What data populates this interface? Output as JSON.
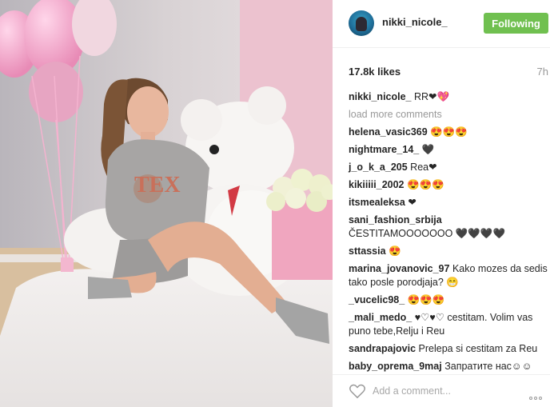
{
  "post": {
    "author": "nikki_nicole_",
    "follow_label": "Following",
    "likes": "17.8k likes",
    "time_ago": "7h",
    "load_more": "load more comments",
    "add_comment_placeholder": "Add a comment...",
    "caption": {
      "user": "nikki_nicole_",
      "text": " RR❤💖"
    },
    "comments": [
      {
        "user": "helena_vasic369",
        "text": " 😍😍😍"
      },
      {
        "user": "nightmare_14_",
        "text": " 🖤"
      },
      {
        "user": "j_o_k_a_205",
        "text": " Rea❤"
      },
      {
        "user": "kikiiiii_2002",
        "text": " 😍😍😍"
      },
      {
        "user": "itsmealeksa",
        "text": " ❤"
      },
      {
        "user": "sani_fashion_srbija",
        "text": " ČESTITAMOOOOOOO 🖤🖤🖤🖤"
      },
      {
        "user": "sttassia",
        "text": " 😍"
      },
      {
        "user": "marina_jovanovic_97",
        "text": " Kako mozes da sedis tako posle porodjaja? 😁"
      },
      {
        "user": "_vucelic98_",
        "text": " 😍😍😍"
      },
      {
        "user": "_mali_medo_",
        "text": " ♥♡♥♡ cestitam. Volim vas puno tebe,Relju i Reu"
      },
      {
        "user": "sandrapajovic",
        "text": " Prelepa si cestitam za Reu"
      },
      {
        "user": "baby_oprema_9maj",
        "text": " Запратите нас☺☺"
      }
    ]
  },
  "colors": {
    "follow_button": "#70c050",
    "username": "#262626",
    "muted": "#999999"
  },
  "icons": {
    "like": "heart-outline-icon",
    "more": "more-options-icon"
  }
}
